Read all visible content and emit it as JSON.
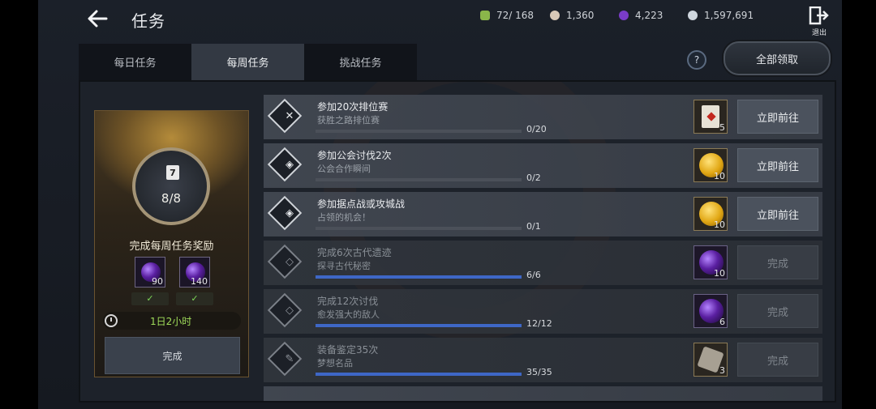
{
  "header": {
    "title": "任务",
    "exit_label": "退出",
    "currencies": [
      {
        "name": "stamina-icon",
        "value": "72/ 168",
        "color": "#8ab64a"
      },
      {
        "name": "pearl-icon",
        "value": "1,360",
        "color": "#d9c9b8"
      },
      {
        "name": "purple-gem-icon",
        "value": "4,223",
        "color": "#7a3cc8"
      },
      {
        "name": "silver-coin-icon",
        "value": "1,597,691",
        "color": "#cfd6de"
      }
    ]
  },
  "tabs": [
    {
      "label": "每日任务",
      "active": false
    },
    {
      "label": "每周任务",
      "active": true
    },
    {
      "label": "挑战任务",
      "active": false
    }
  ],
  "claim_all_label": "全部领取",
  "help_icon": "?",
  "reward_card": {
    "calendar_number": "7",
    "progress": "8/8",
    "title": "完成每周任务奖励",
    "items": [
      {
        "icon": "purple-orb-icon",
        "qty": "90"
      },
      {
        "icon": "purple-orb-icon",
        "qty": "140"
      }
    ],
    "check_icon": "✓",
    "timer": "1日2小时",
    "button": "完成"
  },
  "tasks": [
    {
      "title": "参加20次排位赛",
      "subtitle": "获胜之路排位赛",
      "count": "0/20",
      "progress": 0,
      "reward_icon": "scroll-icon",
      "reward_qty": "5",
      "action": "立即前往",
      "done": false,
      "glyph": "✕"
    },
    {
      "title": "参加公会讨伐2次",
      "subtitle": "公会合作瞬间",
      "count": "0/2",
      "progress": 0,
      "reward_icon": "gold-coin-icon",
      "reward_qty": "10",
      "action": "立即前往",
      "done": false,
      "glyph": "◈"
    },
    {
      "title": "参加据点战或攻城战",
      "subtitle": "占领的机会！",
      "count": "0/1",
      "progress": 0,
      "reward_icon": "gold-coin-icon",
      "reward_qty": "10",
      "action": "立即前往",
      "done": false,
      "glyph": "◈"
    },
    {
      "title": "完成6次古代遗迹",
      "subtitle": "探寻古代秘密",
      "count": "6/6",
      "progress": 1,
      "reward_icon": "purple-orb-icon",
      "reward_qty": "10",
      "action": "完成",
      "done": true,
      "glyph": "◇"
    },
    {
      "title": "完成12次讨伐",
      "subtitle": "愈发强大的敌人",
      "count": "12/12",
      "progress": 1,
      "reward_icon": "purple-orb-icon",
      "reward_qty": "6",
      "action": "完成",
      "done": true,
      "glyph": "◇"
    },
    {
      "title": "装备鉴定35次",
      "subtitle": "梦想名品",
      "count": "35/35",
      "progress": 1,
      "reward_icon": "stone-icon",
      "reward_qty": "3",
      "action": "完成",
      "done": true,
      "glyph": "✎"
    }
  ]
}
